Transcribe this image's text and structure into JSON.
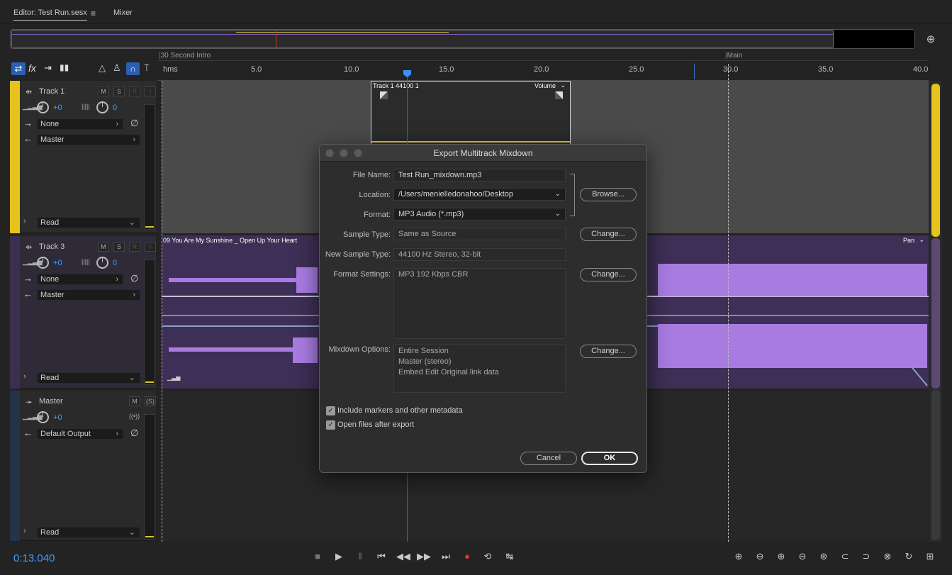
{
  "tabs": [
    {
      "label": "Editor: Test Run.sesx",
      "active": true
    },
    {
      "label": "Mixer",
      "active": false
    }
  ],
  "toolbar_icons": [
    "swap-icon",
    "fx-icon",
    "send-icon",
    "eq-icon",
    "metronome-icon",
    "pitch-icon",
    "snap-icon",
    "pin-icon"
  ],
  "ruler": {
    "unit_label": "hms",
    "ticks": [
      "5.0",
      "10.0",
      "15.0",
      "20.0",
      "25.0",
      "30.0",
      "35.0",
      "40.0"
    ],
    "markers": [
      "30 Second Intro",
      "Main"
    ]
  },
  "tracks": [
    {
      "name": "Track 1",
      "buttons": [
        "M",
        "S",
        "R",
        "I"
      ],
      "volume": "+0",
      "pan": "0",
      "input": "None",
      "output": "Master",
      "automation": "Read",
      "color": "#e8c21d",
      "clip": {
        "title": "Track 1 44100 1",
        "envelope": "Volume"
      }
    },
    {
      "name": "Track 3",
      "buttons": [
        "M",
        "S",
        "R",
        "I"
      ],
      "volume": "+0",
      "pan": "0",
      "input": "None",
      "output": "Master",
      "automation": "Read",
      "color": "#6a4fa0",
      "clip": {
        "title": "09 You Are My Sunshine _ Open Up Your Heart",
        "envelope": "Pan"
      }
    },
    {
      "name": "Master",
      "buttons": [
        "M",
        "(S)"
      ],
      "volume": "+0",
      "output": "Default Output",
      "automation": "Read",
      "color": "#2b3e5a"
    }
  ],
  "transport": {
    "timecode": "0:13.040",
    "buttons": [
      "stop-icon",
      "play-icon",
      "pause-icon",
      "go-start-icon",
      "rewind-icon",
      "fast-forward-icon",
      "go-end-icon",
      "record-icon",
      "loop-icon",
      "skip-selection-icon"
    ],
    "zoom_buttons": [
      "zoom-in-amplitude-icon",
      "zoom-out-amplitude-icon",
      "zoom-in-time-icon",
      "zoom-out-time-icon",
      "zoom-selection-icon",
      "zoom-in-left-icon",
      "zoom-in-right-icon",
      "zoom-out-full-icon",
      "zoom-reset-icon",
      "zoom-tracks-icon",
      "zoom-vertical-icon"
    ]
  },
  "dialog": {
    "title": "Export Multitrack Mixdown",
    "file_name_label": "File Name:",
    "file_name": "Test Run_mixdown.mp3",
    "location_label": "Location:",
    "location": "/Users/menielledonahoo/Desktop",
    "browse_label": "Browse...",
    "format_label": "Format:",
    "format": "MP3 Audio (*.mp3)",
    "sample_type_label": "Sample Type:",
    "sample_type": "Same as Source",
    "new_sample_type_label": "New Sample Type:",
    "new_sample_type": "44100 Hz Stereo, 32-bit",
    "format_settings_label": "Format Settings:",
    "format_settings": "MP3 192 Kbps CBR",
    "mixdown_options_label": "Mixdown Options:",
    "mixdown_options": [
      "Entire Session",
      "Master (stereo)",
      "Embed Edit Original link data"
    ],
    "change_label": "Change...",
    "include_markers_label": "Include markers and other metadata",
    "include_markers": true,
    "open_files_label": "Open files after export",
    "open_files": true,
    "cancel_label": "Cancel",
    "ok_label": "OK"
  }
}
